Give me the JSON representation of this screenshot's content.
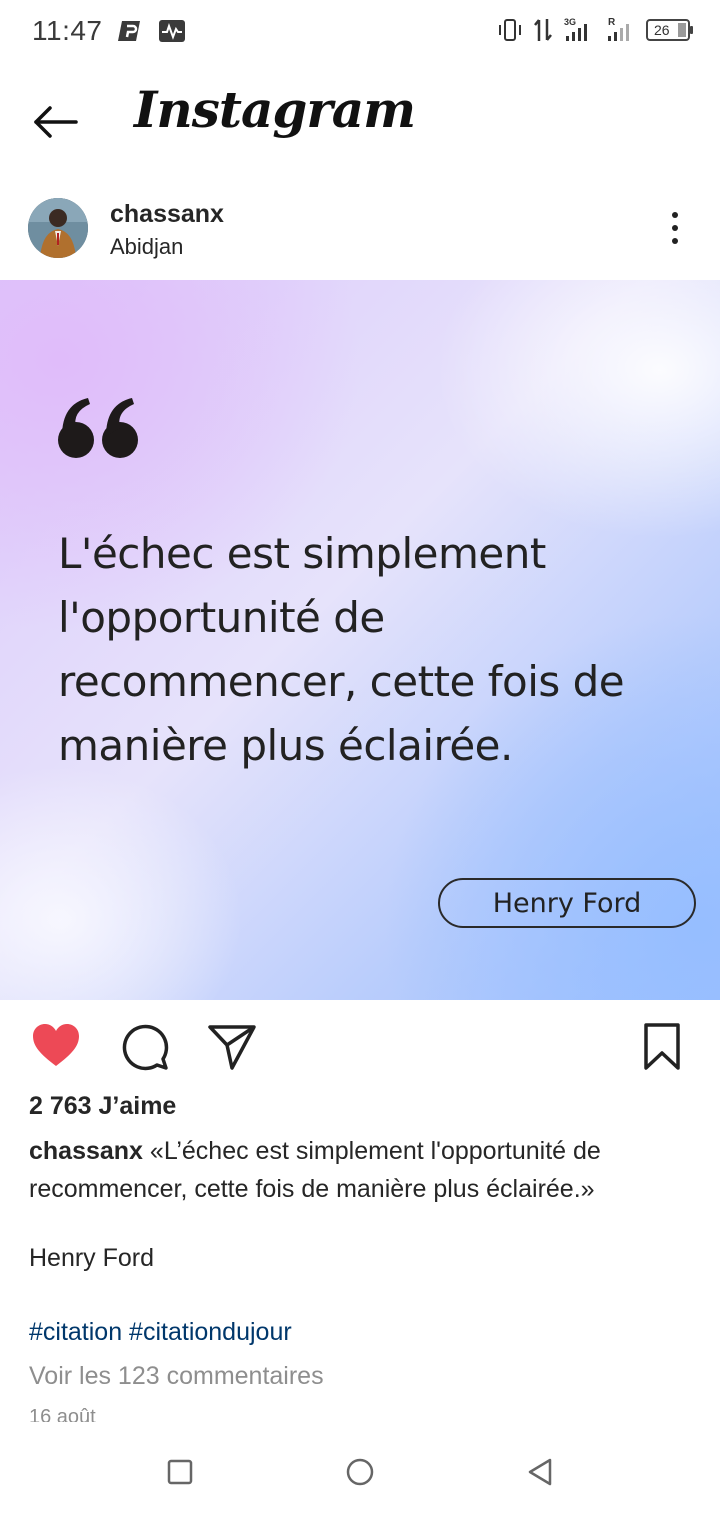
{
  "status_bar": {
    "time": "11:47",
    "battery": "26"
  },
  "header": {
    "title": "Instagram"
  },
  "post": {
    "author": "chassanx",
    "location": "Abidjan",
    "image": {
      "quote": "L'échec est simplement l'opportunité de recommencer, cette fois de manière plus éclairée.",
      "author_pill": "Henry Ford"
    },
    "likes": "2 763 J’aime",
    "caption_text": "«L’échec est simplement l'opportunité de recommencer, cette fois de manière plus éclairée.»",
    "caption_author": "Henry Ford",
    "hashtags": "#citation #citationdujour",
    "view_comments": "Voir les 123 commentaires",
    "date": "16 août"
  },
  "colors": {
    "like_red": "#ed4956",
    "hashtag_blue": "#00376b",
    "muted_gray": "#8e8e8e"
  },
  "icons": [
    "back-arrow-icon",
    "more-vertical-icon",
    "heart-icon",
    "comment-icon",
    "send-icon",
    "bookmark-icon"
  ]
}
